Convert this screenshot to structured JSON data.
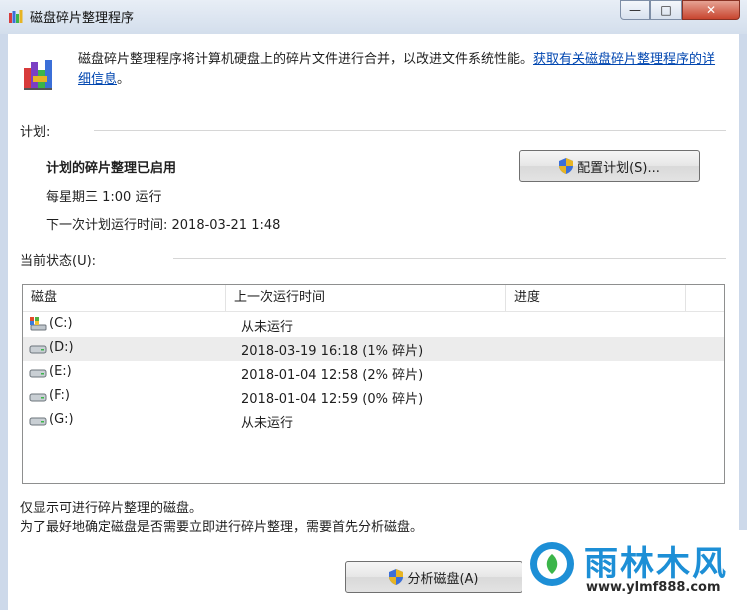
{
  "window": {
    "title": "磁盘碎片整理程序",
    "min_glyph": "—",
    "max_glyph": "□",
    "close_glyph": "✕"
  },
  "intro": {
    "text": "磁盘碎片整理程序将计算机硬盘上的碎片文件进行合并，以改进文件系统性能。",
    "link": "获取有关磁盘碎片整理程序的详细信息",
    "tail": "。"
  },
  "schedule": {
    "section_label": "计划:",
    "status": "计划的碎片整理已启用",
    "frequency": "每星期三  1:00 运行",
    "next_run": "下一次计划运行时间: 2018-03-21 1:48",
    "configure_button": "配置计划(S)..."
  },
  "current_status": {
    "section_label": "当前状态(U):",
    "columns": [
      "磁盘",
      "上一次运行时间",
      "进度"
    ],
    "rows": [
      {
        "disk": "(C:)",
        "last_run": "从未运行",
        "progress": "",
        "icon": "system-drive-icon"
      },
      {
        "disk": "(D:)",
        "last_run": "2018-03-19 16:18 (1% 碎片)",
        "progress": "",
        "icon": "drive-icon",
        "selected": true
      },
      {
        "disk": "(E:)",
        "last_run": "2018-01-04 12:58 (2% 碎片)",
        "progress": "",
        "icon": "drive-icon"
      },
      {
        "disk": "(F:)",
        "last_run": "2018-01-04 12:59 (0% 碎片)",
        "progress": "",
        "icon": "drive-icon"
      },
      {
        "disk": "(G:)",
        "last_run": "从未运行",
        "progress": "",
        "icon": "drive-icon"
      }
    ]
  },
  "notes": {
    "line1": "仅显示可进行碎片整理的磁盘。",
    "line2": "为了最好地确定磁盘是否需要立即进行碎片整理，需要首先分析磁盘。"
  },
  "actions": {
    "analyze_button": "分析磁盘(A)"
  },
  "watermark": {
    "brand": "雨林木风",
    "url": "www.ylmf888.com"
  },
  "colors": {
    "link": "#0046b0",
    "close": "#c8452f",
    "frame": "#cdd9ea"
  }
}
